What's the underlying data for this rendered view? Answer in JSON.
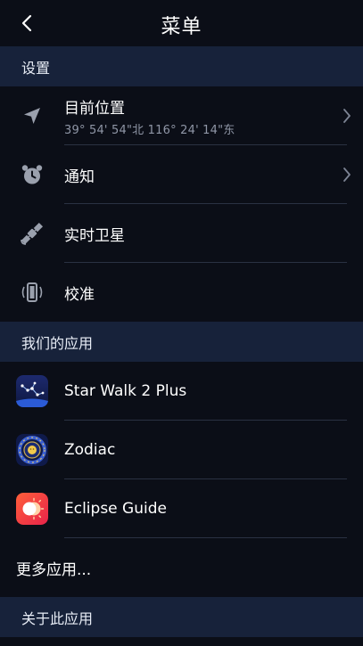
{
  "header": {
    "title": "菜单",
    "back_icon": "chevron-left-icon"
  },
  "sections": {
    "settings": {
      "title": "设置",
      "items": [
        {
          "label": "目前位置",
          "sublabel": "39° 54' 54\"北 116° 24' 14\"东",
          "icon": "location-arrow-icon",
          "has_chevron": true
        },
        {
          "label": "通知",
          "icon": "alarm-clock-icon",
          "has_chevron": true
        },
        {
          "label": "实时卫星",
          "icon": "satellite-icon",
          "has_chevron": false
        },
        {
          "label": "校准",
          "icon": "phone-calibrate-icon",
          "has_chevron": false
        }
      ]
    },
    "apps": {
      "title": "我们的应用",
      "items": [
        {
          "label": "Star Walk 2 Plus",
          "icon": "star-walk-app-icon"
        },
        {
          "label": "Zodiac",
          "icon": "zodiac-app-icon"
        },
        {
          "label": "Eclipse Guide",
          "icon": "eclipse-guide-app-icon"
        }
      ],
      "more_label": "更多应用..."
    },
    "about": {
      "title": "关于此应用"
    }
  },
  "colors": {
    "background": "#0b0e17",
    "section_header": "#17223a",
    "divider": "#2a3142",
    "icon_gray": "#9aa0ad",
    "subtext": "#8f96a6"
  }
}
